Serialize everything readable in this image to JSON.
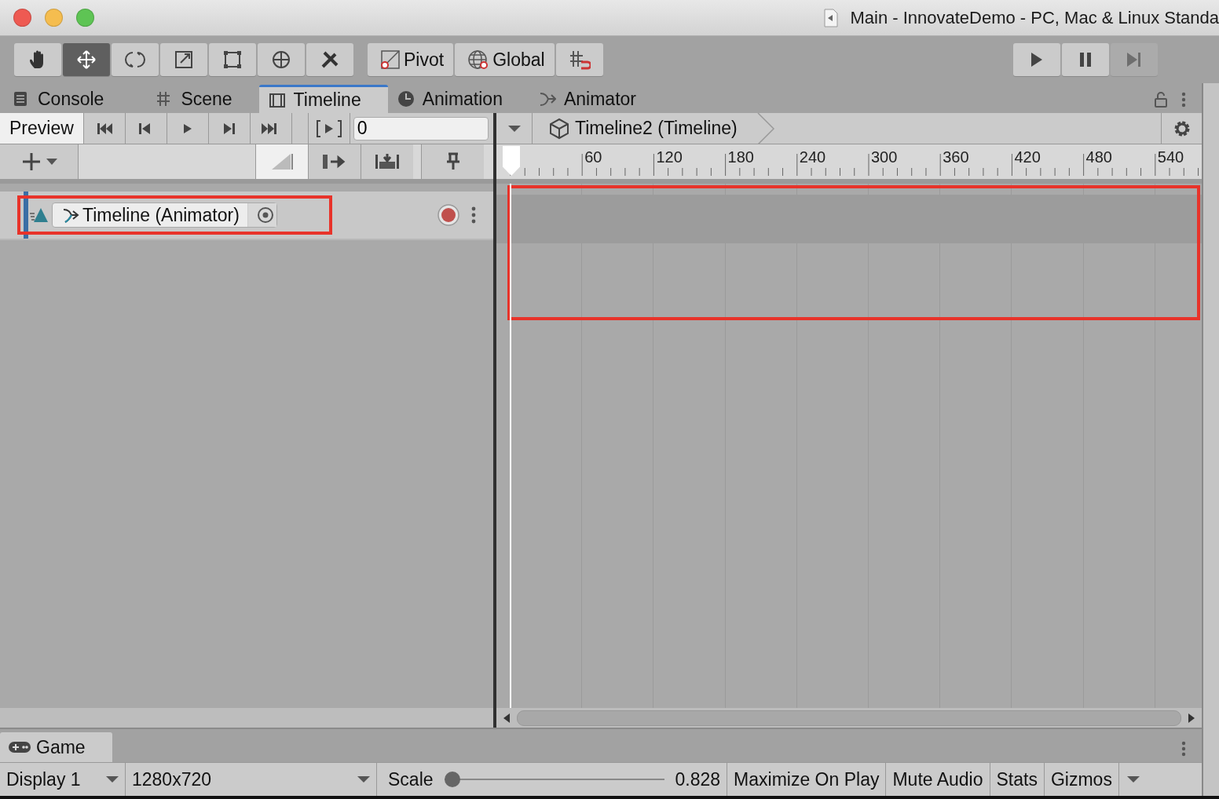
{
  "window": {
    "title": "Main - InnovateDemo - PC, Mac & Linux Standa"
  },
  "toolbar": {
    "tools": [
      {
        "selected": false
      },
      {
        "selected": true
      },
      {
        "selected": false
      },
      {
        "selected": false
      },
      {
        "selected": false
      },
      {
        "selected": false
      },
      {
        "selected": false
      }
    ],
    "pivot": "Pivot",
    "global": "Global",
    "playback": [
      {
        "disabled": false
      },
      {
        "disabled": false
      },
      {
        "disabled": true
      }
    ]
  },
  "tabs": [
    {
      "label": "Console",
      "selected": false
    },
    {
      "label": "Scene",
      "selected": false
    },
    {
      "label": "Timeline",
      "selected": true
    },
    {
      "label": "Animation",
      "selected": false
    },
    {
      "label": "Animator",
      "selected": false
    }
  ],
  "timeline": {
    "preview": {
      "label": "Preview",
      "on": true
    },
    "frame": {
      "value": "0"
    },
    "breadcrumb": "Timeline2 (Timeline)",
    "ruler": [
      "60",
      "120",
      "180",
      "240",
      "300",
      "360",
      "420",
      "480",
      "540"
    ],
    "tracks": [
      {
        "binding": "Timeline (Animator)",
        "highlighted": true
      }
    ],
    "clip_area": {
      "highlighted": true
    }
  },
  "game": {
    "tab": "Game",
    "display": "Display 1",
    "resolution": "1280x720",
    "scale": {
      "label": "Scale",
      "level": 0,
      "reading": "0.828"
    },
    "buttons": [
      "Maximize On Play",
      "Mute Audio",
      "Stats",
      "Gizmos"
    ]
  }
}
